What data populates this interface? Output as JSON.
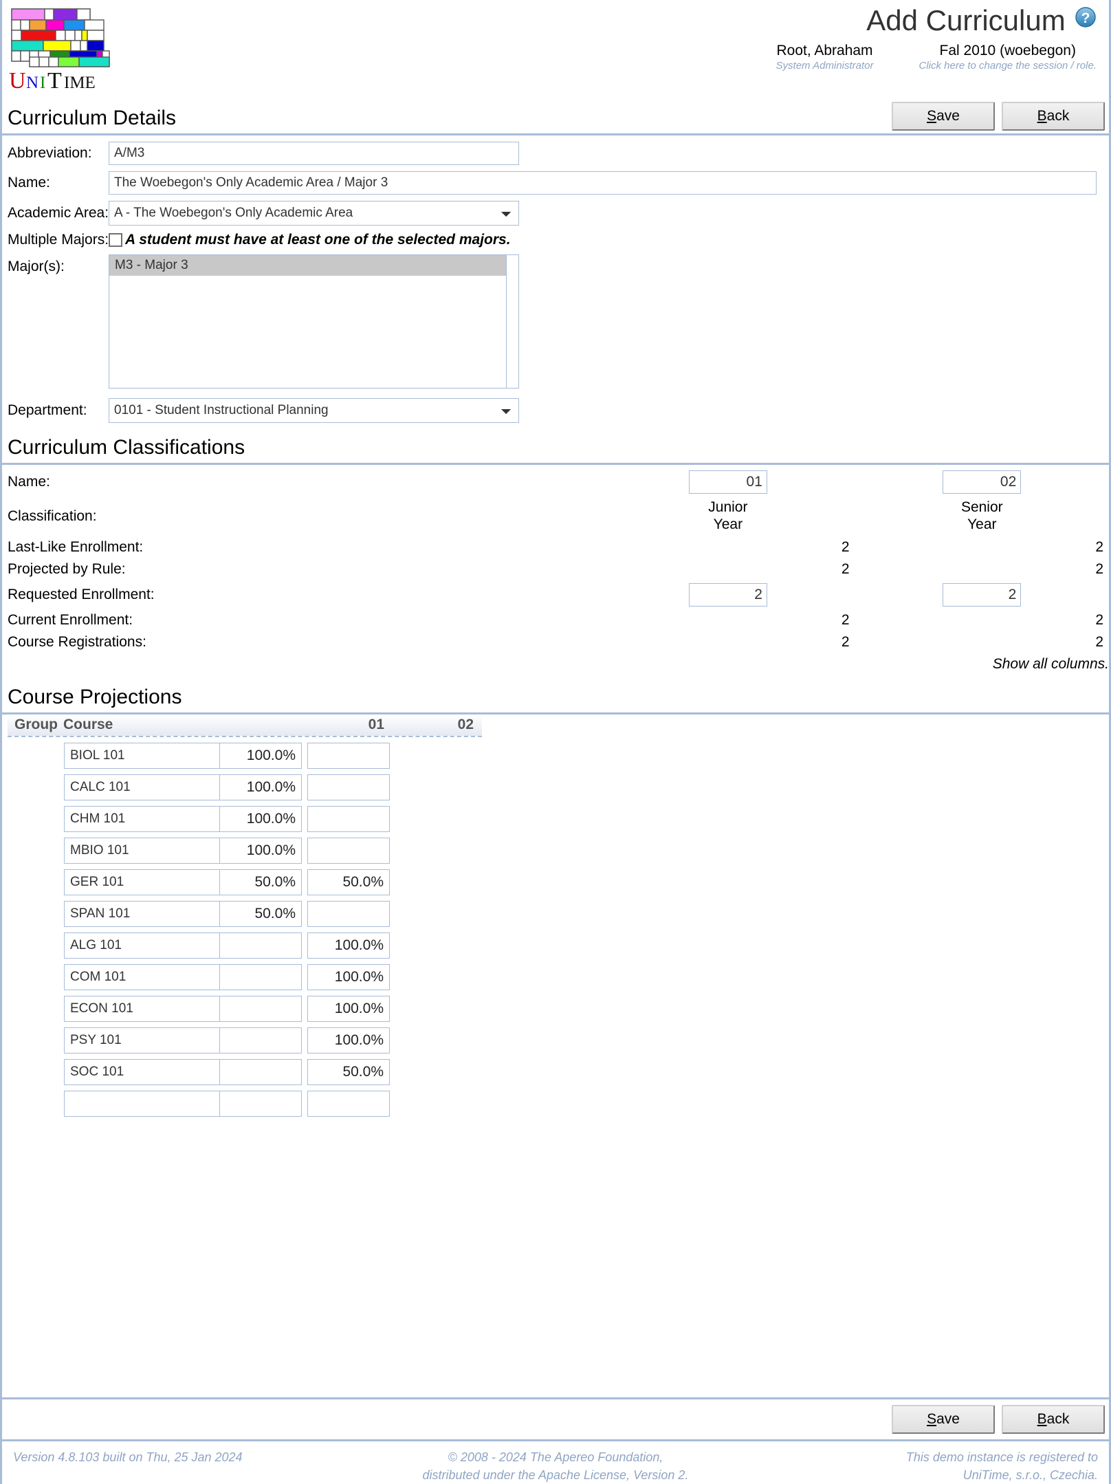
{
  "header": {
    "title": "Add Curriculum",
    "help_icon": "help-question-icon",
    "user_name": "Root, Abraham",
    "user_role": "System Administrator",
    "session": "Fal 2010 (woebegon)",
    "session_hint": "Click here to change the session / role."
  },
  "details": {
    "section_title": "Curriculum Details",
    "save_label": "Save",
    "back_label": "Back",
    "abbreviation_label": "Abbreviation:",
    "abbreviation_value": "A/M3",
    "name_label": "Name:",
    "name_value": "The Woebegon's Only Academic Area / Major 3",
    "academic_area_label": "Academic Area:",
    "academic_area_value": "A - The Woebegon's Only Academic Area",
    "multiple_majors_label": "Multiple Majors:",
    "multiple_majors_text": "A student must have at least one of the selected majors.",
    "multiple_majors_checked": false,
    "majors_label": "Major(s):",
    "majors_options": [
      "M3 - Major 3"
    ],
    "department_label": "Department:",
    "department_value": "0101 - Student Instructional Planning"
  },
  "classifications": {
    "section_title": "Curriculum Classifications",
    "columns": [
      "01",
      "02"
    ],
    "rows": [
      {
        "label": "Name:",
        "type": "input",
        "values": [
          "01",
          "02"
        ]
      },
      {
        "label": "Classification:",
        "type": "header",
        "values": [
          "Junior\nYear",
          "Senior\nYear"
        ]
      },
      {
        "label": "Last-Like Enrollment:",
        "type": "text",
        "values": [
          "2",
          "2"
        ]
      },
      {
        "label": "Projected by Rule:",
        "type": "text",
        "values": [
          "2",
          "2"
        ]
      },
      {
        "label": "Requested Enrollment:",
        "type": "input",
        "values": [
          "2",
          "2"
        ]
      },
      {
        "label": "Current Enrollment:",
        "type": "text",
        "values": [
          "2",
          "2"
        ]
      },
      {
        "label": "Course Registrations:",
        "type": "text",
        "values": [
          "2",
          "2"
        ]
      }
    ],
    "show_all_columns": "Show all columns."
  },
  "projections": {
    "section_title": "Course Projections",
    "col_group": "Group",
    "col_course": "Course",
    "col_01": "01",
    "col_02": "02",
    "search_icon": "magnifier-icon",
    "rows": [
      {
        "group": "",
        "course": "BIOL 101",
        "p01": "100.0%",
        "p02": ""
      },
      {
        "group": "",
        "course": "CALC 101",
        "p01": "100.0%",
        "p02": ""
      },
      {
        "group": "",
        "course": "CHM 101",
        "p01": "100.0%",
        "p02": ""
      },
      {
        "group": "",
        "course": "MBIO 101",
        "p01": "100.0%",
        "p02": ""
      },
      {
        "group": "",
        "course": "GER 101",
        "p01": "50.0%",
        "p02": "50.0%"
      },
      {
        "group": "",
        "course": "SPAN 101",
        "p01": "50.0%",
        "p02": ""
      },
      {
        "group": "",
        "course": "ALG 101",
        "p01": "",
        "p02": "100.0%"
      },
      {
        "group": "",
        "course": "COM 101",
        "p01": "",
        "p02": "100.0%"
      },
      {
        "group": "",
        "course": "ECON 101",
        "p01": "",
        "p02": "100.0%"
      },
      {
        "group": "",
        "course": "PSY 101",
        "p01": "",
        "p02": "100.0%"
      },
      {
        "group": "",
        "course": "SOC 101",
        "p01": "",
        "p02": "50.0%"
      },
      {
        "group": "",
        "course": "",
        "p01": "",
        "p02": ""
      }
    ]
  },
  "bottom": {
    "save_label": "Save",
    "back_label": "Back"
  },
  "footer": {
    "version": "Version 4.8.103 built on Thu, 25 Jan 2024",
    "copyright_line1": "© 2008 - 2024 The Apereo Foundation,",
    "copyright_line2": "distributed under the Apache License, Version 2.",
    "registered_line1": "This demo instance is registered to",
    "registered_line2": "UniTime, s.r.o., Czechia."
  },
  "colors": {
    "rule": "#a8bcd8",
    "muted": "#8fa5c4",
    "selection": "#c8c8c8"
  }
}
